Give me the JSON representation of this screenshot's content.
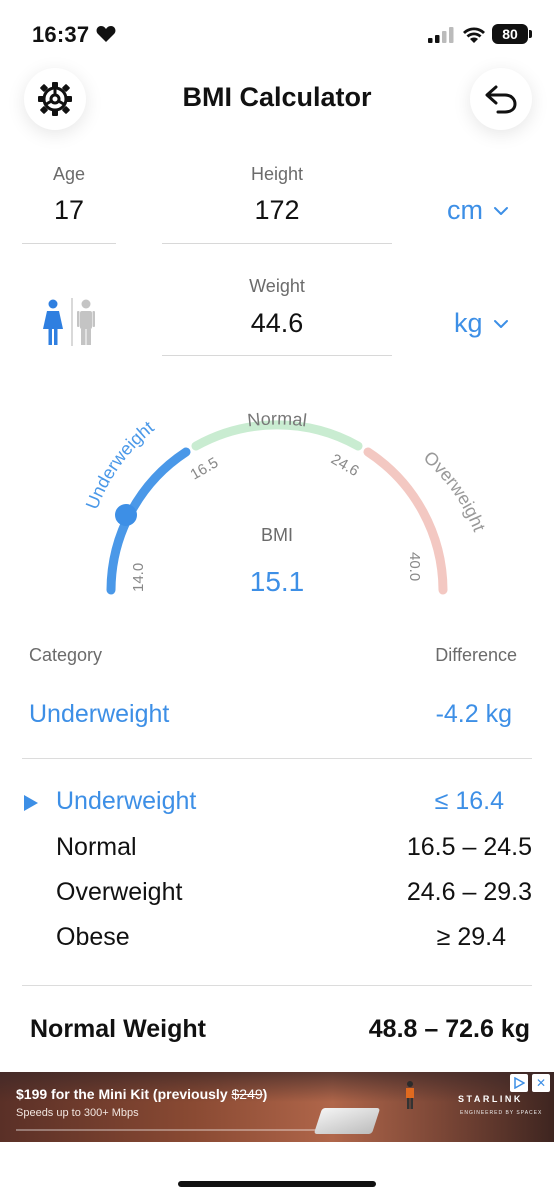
{
  "status_bar": {
    "time": "16:37",
    "battery": "80"
  },
  "header": {
    "title": "BMI Calculator"
  },
  "inputs": {
    "age_label": "Age",
    "age_value": "17",
    "height_label": "Height",
    "height_value": "172",
    "height_unit": "cm",
    "weight_label": "Weight",
    "weight_value": "44.6",
    "weight_unit": "kg"
  },
  "gauge": {
    "zones": [
      {
        "name": "Underweight",
        "from": 14.0,
        "to": 16.5,
        "color": "#4a98e8"
      },
      {
        "name": "Normal",
        "from": 16.5,
        "to": 24.6,
        "color": "#c9ecd1"
      },
      {
        "name": "Overweight",
        "from": 24.6,
        "to": 40.0,
        "color": "#f3c8c2"
      }
    ],
    "ticks": [
      "14.0",
      "16.5",
      "24.6",
      "40.0"
    ],
    "bmi_label": "BMI",
    "bmi_value": "15.1"
  },
  "result": {
    "category_label": "Category",
    "difference_label": "Difference",
    "category_value": "Underweight",
    "difference_value": "-4.2 kg"
  },
  "ranges": [
    {
      "name": "Underweight",
      "range": "≤ 16.4",
      "active": true
    },
    {
      "name": "Normal",
      "range": "16.5 – 24.5",
      "active": false
    },
    {
      "name": "Overweight",
      "range": "24.6 – 29.3",
      "active": false
    },
    {
      "name": "Obese",
      "range": "≥ 29.4",
      "active": false
    }
  ],
  "normal_weight": {
    "label": "Normal Weight",
    "value": "48.8 – 72.6 kg"
  },
  "ad": {
    "headline_prefix": "$199 for the Mini Kit (previously ",
    "headline_strike": "$249",
    "headline_suffix": ")",
    "subline": "Speeds up to 300+ Mbps",
    "brand": "STARLINK",
    "brand_sub": "ENGINEERED BY SPACEX"
  },
  "colors": {
    "accent": "#3d8fe6",
    "normal_zone": "#c9ecd1",
    "overweight_zone": "#f3c8c2"
  }
}
